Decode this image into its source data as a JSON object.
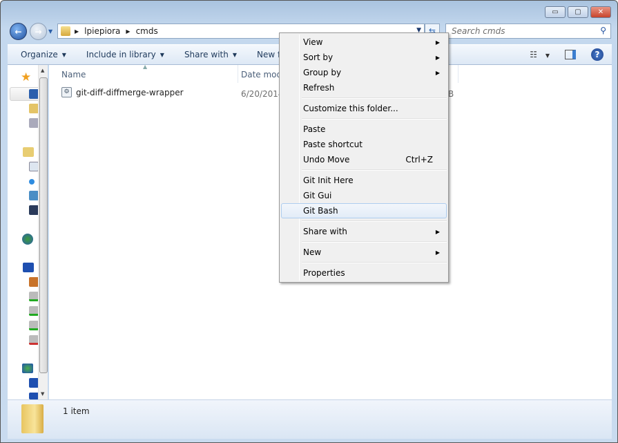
{
  "window": {
    "minimize": "▭",
    "maximize": "▢",
    "close": "✕"
  },
  "address": {
    "crumbs": [
      "lpiepiora",
      "cmds"
    ],
    "search_placeholder": "Search cmds"
  },
  "toolbar": {
    "organize": "Organize",
    "include": "Include in library",
    "share": "Share with",
    "new_folder": "New folder"
  },
  "columns": {
    "name": "Name",
    "date": "Date modified",
    "size_fragment": "B"
  },
  "files": [
    {
      "name": "git-diff-diffmerge-wrapper",
      "date": "6/20/2014"
    }
  ],
  "status": {
    "count": "1 item"
  },
  "context_menu": {
    "items": [
      {
        "label": "View",
        "submenu": true
      },
      {
        "label": "Sort by",
        "submenu": true
      },
      {
        "label": "Group by",
        "submenu": true
      },
      {
        "label": "Refresh"
      },
      {
        "sep": true
      },
      {
        "label": "Customize this folder..."
      },
      {
        "sep": true
      },
      {
        "label": "Paste"
      },
      {
        "label": "Paste shortcut"
      },
      {
        "label": "Undo Move",
        "shortcut": "Ctrl+Z"
      },
      {
        "sep": true
      },
      {
        "label": "Git Init Here"
      },
      {
        "label": "Git Gui"
      },
      {
        "label": "Git Bash",
        "hover": true
      },
      {
        "sep": true
      },
      {
        "label": "Share with",
        "submenu": true
      },
      {
        "sep": true
      },
      {
        "label": "New",
        "submenu": true
      },
      {
        "sep": true
      },
      {
        "label": "Properties"
      }
    ]
  }
}
